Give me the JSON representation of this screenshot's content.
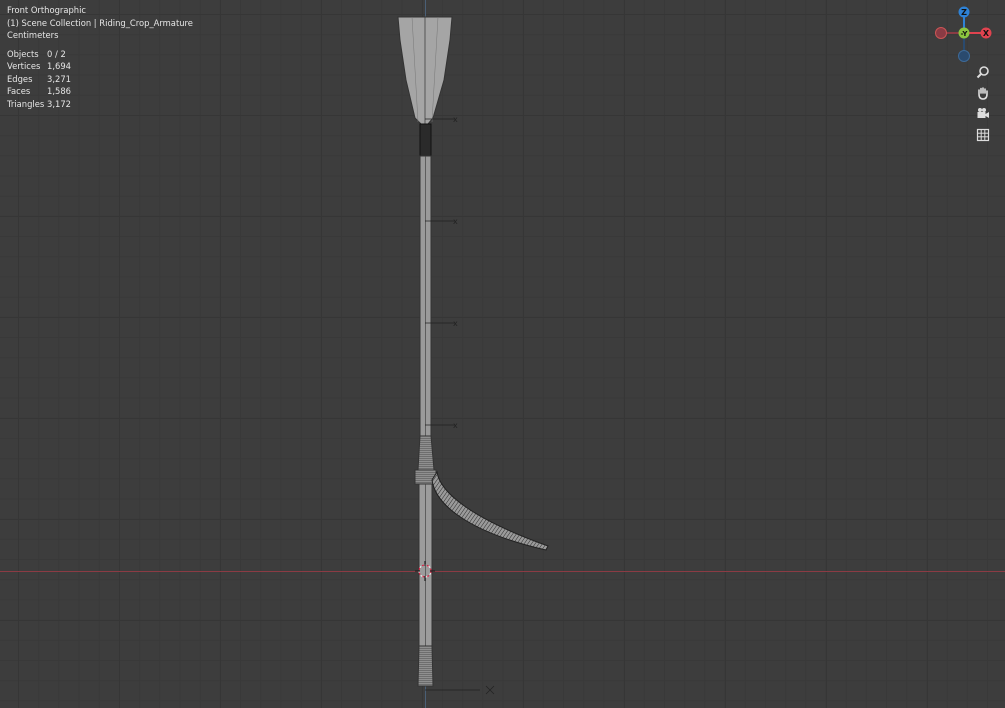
{
  "viewport": {
    "view_name": "Front Orthographic",
    "collection_line": "(1) Scene Collection | Riding_Crop_Armature",
    "units": "Centimeters"
  },
  "stats": [
    {
      "label": "Objects",
      "value": "0 / 2"
    },
    {
      "label": "Vertices",
      "value": "1,694"
    },
    {
      "label": "Edges",
      "value": "3,271"
    },
    {
      "label": "Faces",
      "value": "1,586"
    },
    {
      "label": "Triangles",
      "value": "3,172"
    }
  ],
  "gizmo": {
    "z_label": "Z",
    "y_label": "-Y",
    "x_label": "X",
    "colors": {
      "x": "#e0434f",
      "y": "#8cc63f",
      "z": "#2e82d6"
    }
  },
  "nav_icons": [
    "zoom-icon",
    "pan-hand-icon",
    "camera-icon",
    "grid-icon"
  ],
  "colors": {
    "background": "#3d3d3d",
    "x_axis_line": "#8b3b44",
    "z_axis_line": "#4a5f76"
  }
}
